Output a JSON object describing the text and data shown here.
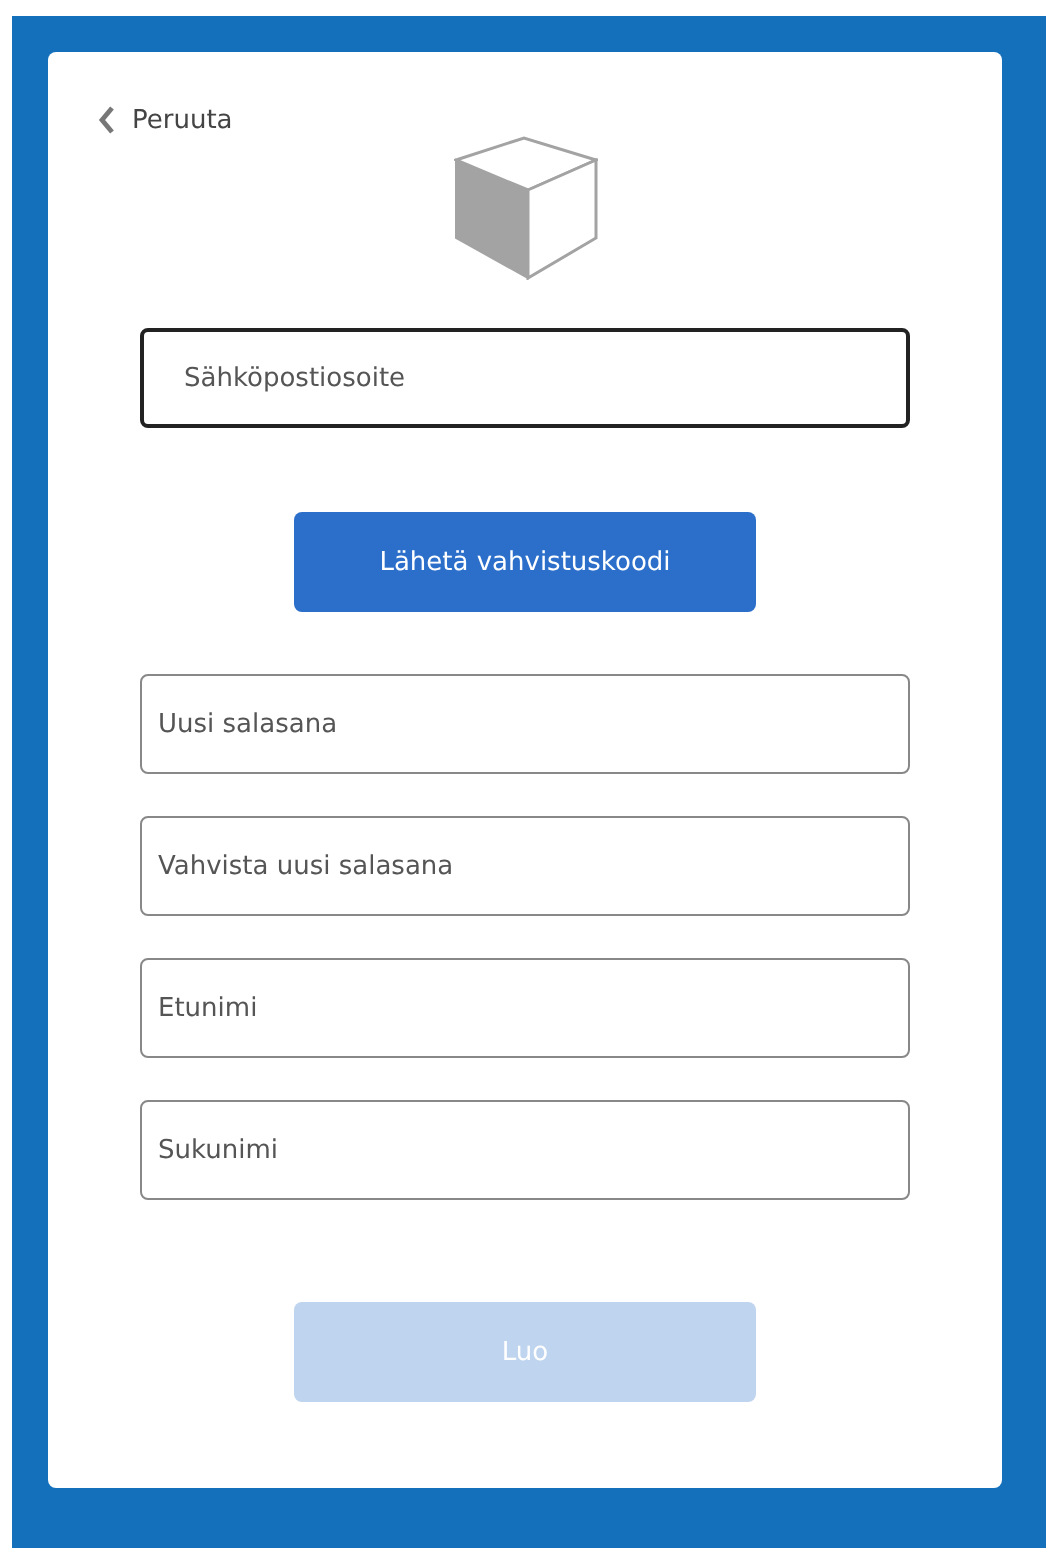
{
  "back_link": {
    "label": "Peruuta"
  },
  "email_field": {
    "placeholder": "Sähköpostiosoite",
    "focused": true
  },
  "send_button": {
    "label": "Lähetä vahvistuskoodi",
    "disabled": false
  },
  "fields": [
    {
      "placeholder": "Uusi salasana",
      "focused": false
    },
    {
      "placeholder": "Vahvista uusi salasana",
      "focused": false
    },
    {
      "placeholder": "Etunimi",
      "focused": false
    },
    {
      "placeholder": "Sukunimi",
      "focused": false
    }
  ],
  "create_button": {
    "label": "Luo",
    "disabled": true
  }
}
